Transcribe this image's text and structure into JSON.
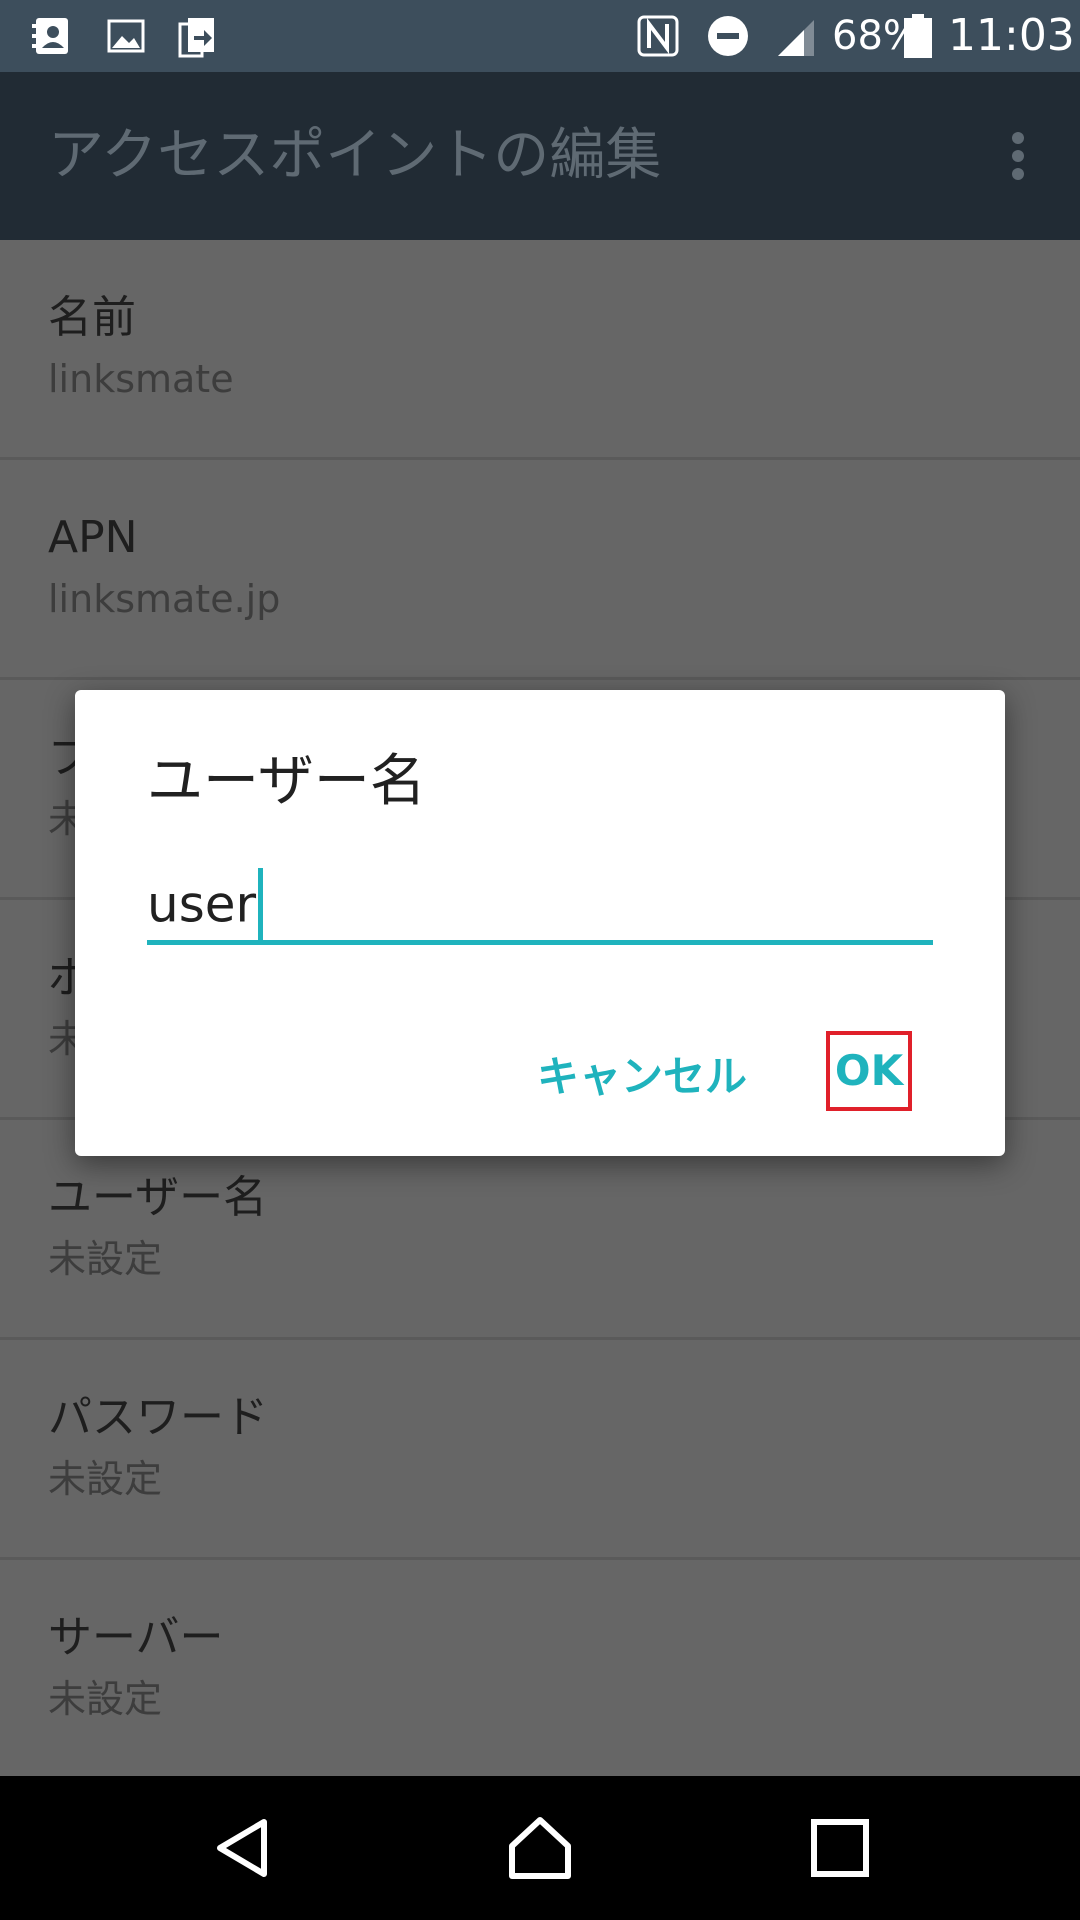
{
  "status_bar": {
    "icons_left": [
      "contacts-icon",
      "image-icon",
      "sync-transfer-icon"
    ],
    "icons_right": [
      "nfc-icon",
      "do-not-disturb-icon",
      "signal-icon",
      "battery-icon"
    ],
    "battery": "68%",
    "time": "11:03"
  },
  "app_bar": {
    "title": "アクセスポイントの編集",
    "menu_icon": "more-vert-icon"
  },
  "list": {
    "items": [
      {
        "title": "名前",
        "value": "linksmate"
      },
      {
        "title": "APN",
        "value": "linksmate.jp"
      },
      {
        "title": "プ",
        "value": "未"
      },
      {
        "title": "ポ",
        "value": "未"
      },
      {
        "title": "ユーザー名",
        "value": "未設定"
      },
      {
        "title": "パスワード",
        "value": "未設定"
      },
      {
        "title": "サーバー",
        "value": "未設定"
      }
    ]
  },
  "dialog": {
    "title": "ユーザー名",
    "input_value": "user",
    "cancel_label": "キャンセル",
    "ok_label": "OK"
  },
  "colors": {
    "accent": "#1fb3bd",
    "highlight": "#e0202a",
    "status_bar": "#3d4e5c",
    "app_bar": "#212b34"
  },
  "nav_bar": {
    "icons": [
      "back-icon",
      "home-icon",
      "recents-icon"
    ]
  }
}
